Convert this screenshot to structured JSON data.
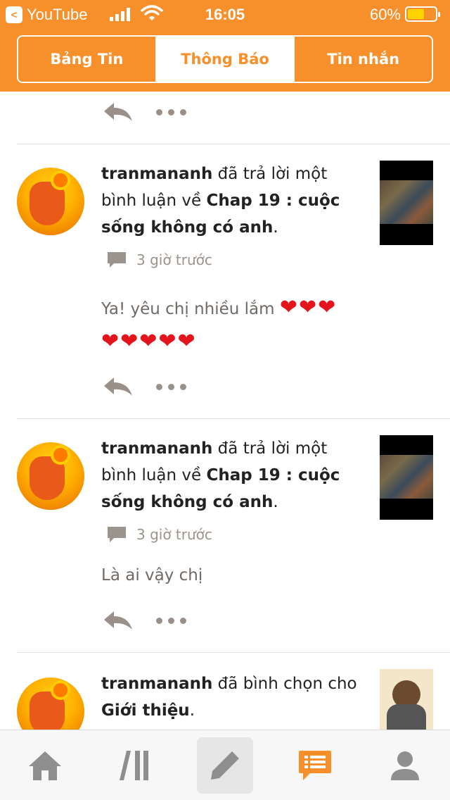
{
  "status_bar": {
    "back_app": "YouTube",
    "time": "16:05",
    "battery": "60%",
    "battery_level": 0.6
  },
  "tabs": [
    {
      "label": "Bảng Tin",
      "active": false
    },
    {
      "label": "Thông Báo",
      "active": true
    },
    {
      "label": "Tin nhắn",
      "active": false
    }
  ],
  "notifications": [
    {
      "user": "tranmananh",
      "action": " đã trả lời một bình luận về ",
      "target": "Chap 19 : cuộc sống không có anh",
      "end": ".",
      "time": "3 giờ trước",
      "message": "Ya! yêu chị nhiều lắm",
      "hearts_line1": "❤❤❤",
      "hearts_line2": "❤❤❤❤❤"
    },
    {
      "user": "tranmananh",
      "action": " đã trả lời một bình luận về ",
      "target": "Chap 19 : cuộc sống không có anh",
      "end": ".",
      "time": "3 giờ trước",
      "message": "Là ai vậy chị"
    },
    {
      "user": "tranmananh",
      "action": " đã bình chọn cho ",
      "target": "Giới thiệu",
      "end": "."
    }
  ],
  "icons": {
    "reply": "reply-icon",
    "more": "more-icon",
    "comment": "comment-icon"
  },
  "bottom_nav": [
    {
      "name": "home-icon"
    },
    {
      "name": "library-icon"
    },
    {
      "name": "write-icon"
    },
    {
      "name": "notifications-icon"
    },
    {
      "name": "profile-icon"
    }
  ],
  "colors": {
    "accent": "#f7902a",
    "muted": "#9b948d",
    "heart": "#e3141b"
  }
}
